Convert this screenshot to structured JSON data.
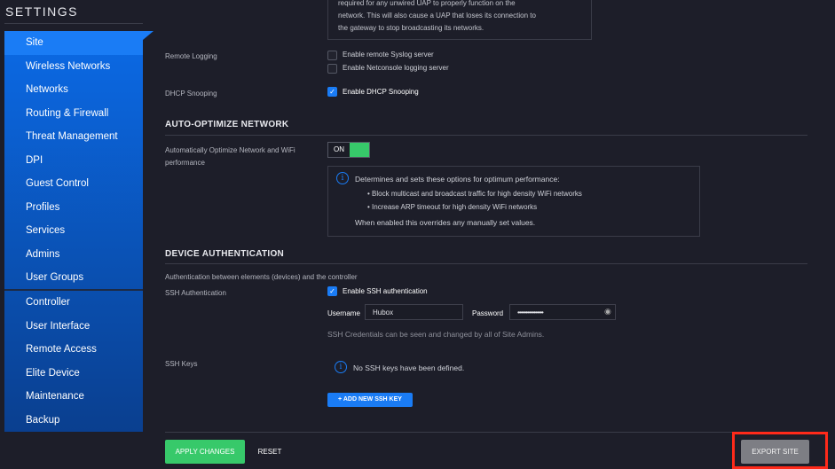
{
  "sidebar": {
    "title": "SETTINGS",
    "items": [
      {
        "label": "Site"
      },
      {
        "label": "Wireless Networks"
      },
      {
        "label": "Networks"
      },
      {
        "label": "Routing & Firewall"
      },
      {
        "label": "Threat Management"
      },
      {
        "label": "DPI"
      },
      {
        "label": "Guest Control"
      },
      {
        "label": "Profiles"
      },
      {
        "label": "Services"
      },
      {
        "label": "Admins"
      },
      {
        "label": "User Groups"
      },
      {
        "label": "Controller"
      },
      {
        "label": "User Interface"
      },
      {
        "label": "Remote Access"
      },
      {
        "label": "Elite Device"
      },
      {
        "label": "Maintenance"
      },
      {
        "label": "Backup"
      }
    ],
    "active": "Site"
  },
  "top_note": {
    "lines": [
      "required for any unwired UAP to properly function on the",
      "network. This will also cause a UAP that loses its connection to",
      "the gateway to stop broadcasting its networks."
    ]
  },
  "remote_logging": {
    "label": "Remote Logging",
    "options": [
      {
        "label": "Enable remote Syslog server",
        "checked": false
      },
      {
        "label": "Enable Netconsole logging server",
        "checked": false
      }
    ]
  },
  "dhcp": {
    "label": "DHCP Snooping",
    "option": "Enable DHCP Snooping",
    "checked": true
  },
  "auto_opt": {
    "heading": "AUTO-OPTIMIZE NETWORK",
    "label": "Automatically Optimize Network and WiFi performance",
    "toggle": "ON",
    "toggle_state": true,
    "info_title": "Determines and sets these options for optimum performance:",
    "bullets": [
      "Block multicast and broadcast traffic for high density WiFi networks",
      "Increase ARP timeout for high density WiFi networks"
    ],
    "info_footer": "When enabled this overrides any manually set values."
  },
  "device_auth": {
    "heading": "DEVICE AUTHENTICATION",
    "subtitle": "Authentication between elements (devices) and the controller",
    "ssh_label": "SSH Authentication",
    "ssh_option": "Enable SSH authentication",
    "ssh_checked": true,
    "username_label": "Username",
    "username": "Hubox",
    "password_label": "Password",
    "password": "••••••••••••••••",
    "note": "SSH Credentials can be seen and changed by all of Site Admins.",
    "keys_label": "SSH Keys",
    "keys_empty": "No SSH keys have been defined.",
    "add_key": "ADD NEW SSH KEY"
  },
  "footer": {
    "apply": "APPLY CHANGES",
    "reset": "RESET",
    "export": "EXPORT SITE"
  },
  "colors": {
    "accent": "#1a7cf5",
    "success": "#37c96a",
    "highlight": "#ff2a1a"
  }
}
